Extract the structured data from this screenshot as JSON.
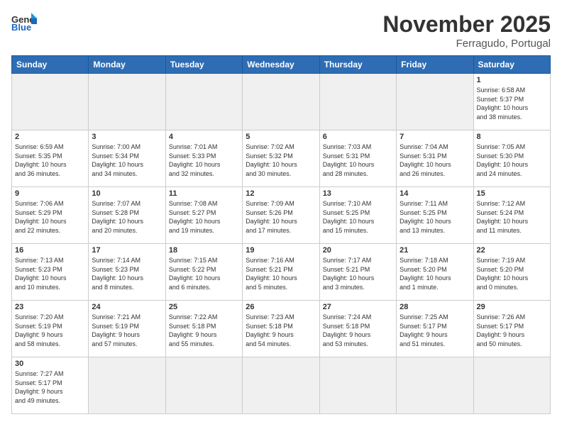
{
  "header": {
    "logo_general": "General",
    "logo_blue": "Blue",
    "month_year": "November 2025",
    "location": "Ferragudo, Portugal"
  },
  "weekdays": [
    "Sunday",
    "Monday",
    "Tuesday",
    "Wednesday",
    "Thursday",
    "Friday",
    "Saturday"
  ],
  "weeks": [
    [
      {
        "day": "",
        "info": ""
      },
      {
        "day": "",
        "info": ""
      },
      {
        "day": "",
        "info": ""
      },
      {
        "day": "",
        "info": ""
      },
      {
        "day": "",
        "info": ""
      },
      {
        "day": "",
        "info": ""
      },
      {
        "day": "1",
        "info": "Sunrise: 6:58 AM\nSunset: 5:37 PM\nDaylight: 10 hours\nand 38 minutes."
      }
    ],
    [
      {
        "day": "2",
        "info": "Sunrise: 6:59 AM\nSunset: 5:35 PM\nDaylight: 10 hours\nand 36 minutes."
      },
      {
        "day": "3",
        "info": "Sunrise: 7:00 AM\nSunset: 5:34 PM\nDaylight: 10 hours\nand 34 minutes."
      },
      {
        "day": "4",
        "info": "Sunrise: 7:01 AM\nSunset: 5:33 PM\nDaylight: 10 hours\nand 32 minutes."
      },
      {
        "day": "5",
        "info": "Sunrise: 7:02 AM\nSunset: 5:32 PM\nDaylight: 10 hours\nand 30 minutes."
      },
      {
        "day": "6",
        "info": "Sunrise: 7:03 AM\nSunset: 5:31 PM\nDaylight: 10 hours\nand 28 minutes."
      },
      {
        "day": "7",
        "info": "Sunrise: 7:04 AM\nSunset: 5:31 PM\nDaylight: 10 hours\nand 26 minutes."
      },
      {
        "day": "8",
        "info": "Sunrise: 7:05 AM\nSunset: 5:30 PM\nDaylight: 10 hours\nand 24 minutes."
      }
    ],
    [
      {
        "day": "9",
        "info": "Sunrise: 7:06 AM\nSunset: 5:29 PM\nDaylight: 10 hours\nand 22 minutes."
      },
      {
        "day": "10",
        "info": "Sunrise: 7:07 AM\nSunset: 5:28 PM\nDaylight: 10 hours\nand 20 minutes."
      },
      {
        "day": "11",
        "info": "Sunrise: 7:08 AM\nSunset: 5:27 PM\nDaylight: 10 hours\nand 19 minutes."
      },
      {
        "day": "12",
        "info": "Sunrise: 7:09 AM\nSunset: 5:26 PM\nDaylight: 10 hours\nand 17 minutes."
      },
      {
        "day": "13",
        "info": "Sunrise: 7:10 AM\nSunset: 5:25 PM\nDaylight: 10 hours\nand 15 minutes."
      },
      {
        "day": "14",
        "info": "Sunrise: 7:11 AM\nSunset: 5:25 PM\nDaylight: 10 hours\nand 13 minutes."
      },
      {
        "day": "15",
        "info": "Sunrise: 7:12 AM\nSunset: 5:24 PM\nDaylight: 10 hours\nand 11 minutes."
      }
    ],
    [
      {
        "day": "16",
        "info": "Sunrise: 7:13 AM\nSunset: 5:23 PM\nDaylight: 10 hours\nand 10 minutes."
      },
      {
        "day": "17",
        "info": "Sunrise: 7:14 AM\nSunset: 5:23 PM\nDaylight: 10 hours\nand 8 minutes."
      },
      {
        "day": "18",
        "info": "Sunrise: 7:15 AM\nSunset: 5:22 PM\nDaylight: 10 hours\nand 6 minutes."
      },
      {
        "day": "19",
        "info": "Sunrise: 7:16 AM\nSunset: 5:21 PM\nDaylight: 10 hours\nand 5 minutes."
      },
      {
        "day": "20",
        "info": "Sunrise: 7:17 AM\nSunset: 5:21 PM\nDaylight: 10 hours\nand 3 minutes."
      },
      {
        "day": "21",
        "info": "Sunrise: 7:18 AM\nSunset: 5:20 PM\nDaylight: 10 hours\nand 1 minute."
      },
      {
        "day": "22",
        "info": "Sunrise: 7:19 AM\nSunset: 5:20 PM\nDaylight: 10 hours\nand 0 minutes."
      }
    ],
    [
      {
        "day": "23",
        "info": "Sunrise: 7:20 AM\nSunset: 5:19 PM\nDaylight: 9 hours\nand 58 minutes."
      },
      {
        "day": "24",
        "info": "Sunrise: 7:21 AM\nSunset: 5:19 PM\nDaylight: 9 hours\nand 57 minutes."
      },
      {
        "day": "25",
        "info": "Sunrise: 7:22 AM\nSunset: 5:18 PM\nDaylight: 9 hours\nand 55 minutes."
      },
      {
        "day": "26",
        "info": "Sunrise: 7:23 AM\nSunset: 5:18 PM\nDaylight: 9 hours\nand 54 minutes."
      },
      {
        "day": "27",
        "info": "Sunrise: 7:24 AM\nSunset: 5:18 PM\nDaylight: 9 hours\nand 53 minutes."
      },
      {
        "day": "28",
        "info": "Sunrise: 7:25 AM\nSunset: 5:17 PM\nDaylight: 9 hours\nand 51 minutes."
      },
      {
        "day": "29",
        "info": "Sunrise: 7:26 AM\nSunset: 5:17 PM\nDaylight: 9 hours\nand 50 minutes."
      }
    ],
    [
      {
        "day": "30",
        "info": "Sunrise: 7:27 AM\nSunset: 5:17 PM\nDaylight: 9 hours\nand 49 minutes."
      },
      {
        "day": "",
        "info": ""
      },
      {
        "day": "",
        "info": ""
      },
      {
        "day": "",
        "info": ""
      },
      {
        "day": "",
        "info": ""
      },
      {
        "day": "",
        "info": ""
      },
      {
        "day": "",
        "info": ""
      }
    ]
  ]
}
